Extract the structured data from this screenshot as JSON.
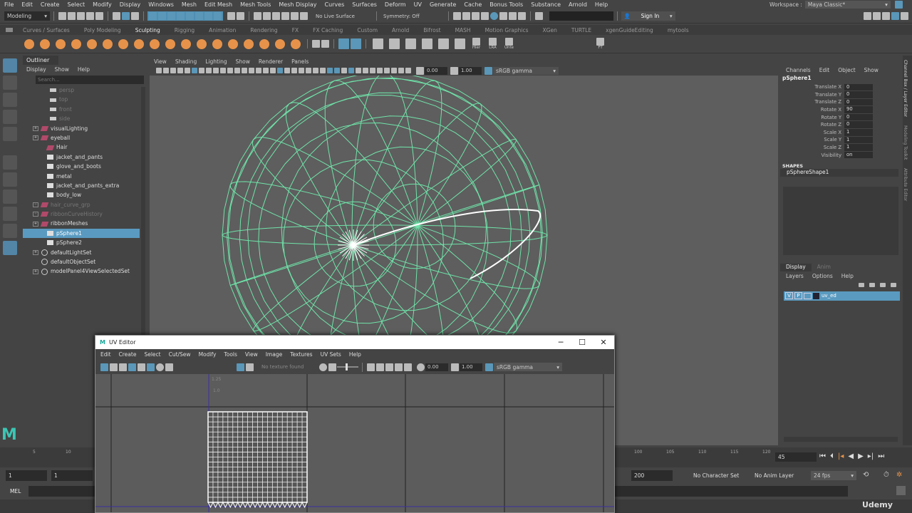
{
  "menubar": [
    "File",
    "Edit",
    "Create",
    "Select",
    "Modify",
    "Display",
    "Windows",
    "Mesh",
    "Edit Mesh",
    "Mesh Tools",
    "Mesh Display",
    "Curves",
    "Surfaces",
    "Deform",
    "UV",
    "Generate",
    "Cache",
    "Bonus Tools",
    "Substance",
    "Arnold",
    "Help"
  ],
  "workspace": {
    "label": "Workspace :",
    "value": "Maya Classic*"
  },
  "status": {
    "mode": "Modeling",
    "live_surface": "No Live Surface",
    "symmetry": "Symmetry: Off",
    "sign_in": "Sign In"
  },
  "shelf_tabs": [
    "Curves / Surfaces",
    "Poly Modeling",
    "Sculpting",
    "Rigging",
    "Animation",
    "Rendering",
    "FX",
    "FX Caching",
    "Custom",
    "Arnold",
    "Bifrost",
    "MASH",
    "Motion Graphics",
    "XGen",
    "TURTLE",
    "xgenGuideEditing",
    "mytools"
  ],
  "shelf_active": "Sculpting",
  "shelf_labels": [
    "Hier",
    "LRA",
    "Unte",
    "FT"
  ],
  "outliner": {
    "title": "Outliner",
    "menu": [
      "Display",
      "Show",
      "Help"
    ],
    "search_placeholder": "Search...",
    "items": [
      {
        "name": "persp",
        "type": "cam",
        "dim": true,
        "exp": false
      },
      {
        "name": "top",
        "type": "cam",
        "dim": true,
        "exp": false
      },
      {
        "name": "front",
        "type": "cam",
        "dim": true,
        "exp": false
      },
      {
        "name": "side",
        "type": "cam",
        "dim": true,
        "exp": false
      },
      {
        "name": "visualLighting",
        "type": "grp",
        "exp": true
      },
      {
        "name": "eyeball",
        "type": "grp",
        "exp": true
      },
      {
        "name": "Hair",
        "type": "grp",
        "exp": false
      },
      {
        "name": "jacket_and_pants",
        "type": "mesh",
        "exp": false
      },
      {
        "name": "glove_and_boots",
        "type": "mesh",
        "exp": false
      },
      {
        "name": "metal",
        "type": "mesh",
        "exp": false
      },
      {
        "name": "jacket_and_pants_extra",
        "type": "mesh",
        "exp": false
      },
      {
        "name": "body_low",
        "type": "mesh",
        "exp": false
      },
      {
        "name": "hair_curve_grp",
        "type": "grp",
        "dim": true,
        "exp": true
      },
      {
        "name": "ribbonCurveHistory",
        "type": "grp",
        "dim": true,
        "exp": true
      },
      {
        "name": "ribbonMeshes",
        "type": "grp",
        "exp": true
      },
      {
        "name": "pSphere1",
        "type": "mesh",
        "exp": false,
        "selected": true
      },
      {
        "name": "pSphere2",
        "type": "mesh",
        "exp": false
      },
      {
        "name": "defaultLightSet",
        "type": "set",
        "exp": true
      },
      {
        "name": "defaultObjectSet",
        "type": "set",
        "exp": false
      },
      {
        "name": "modelPanel4ViewSelectedSet",
        "type": "set",
        "exp": true
      }
    ]
  },
  "viewport": {
    "menu": [
      "View",
      "Shading",
      "Lighting",
      "Show",
      "Renderer",
      "Panels"
    ],
    "exposure": "0.00",
    "gamma": "1.00",
    "colorspace": "sRGB gamma",
    "wire_color": "#6fe3a9"
  },
  "channelbox": {
    "menu": [
      "Channels",
      "Edit",
      "Object",
      "Show"
    ],
    "object": "pSphere1",
    "attrs": [
      {
        "l": "Translate X",
        "v": "0"
      },
      {
        "l": "Translate Y",
        "v": "0"
      },
      {
        "l": "Translate Z",
        "v": "0"
      },
      {
        "l": "Rotate X",
        "v": "90"
      },
      {
        "l": "Rotate Y",
        "v": "0"
      },
      {
        "l": "Rotate Z",
        "v": "0"
      },
      {
        "l": "Scale X",
        "v": "1"
      },
      {
        "l": "Scale Y",
        "v": "1"
      },
      {
        "l": "Scale Z",
        "v": "1"
      },
      {
        "l": "Visibility",
        "v": "on"
      }
    ],
    "shapes_label": "SHAPES",
    "shape": "pSphereShape1"
  },
  "layers": {
    "tabs": [
      "Display",
      "Anim"
    ],
    "menu": [
      "Layers",
      "Options",
      "Help"
    ],
    "layer": {
      "v": "V",
      "p": "P",
      "name": "uv_ed"
    }
  },
  "side_tabs": [
    "Channel Box / Layer Editor",
    "Modeling Toolkit",
    "Attribute Editor"
  ],
  "timeline": {
    "ticks_left": [
      "5",
      "10"
    ],
    "ticks_right": [
      "100",
      "105",
      "110",
      "115",
      "120"
    ],
    "current": "45"
  },
  "range": {
    "start": "1",
    "start2": "1",
    "end": "200",
    "character": "No Character Set",
    "anim_layer": "No Anim Layer",
    "fps": "24 fps"
  },
  "cmd": {
    "lang": "MEL"
  },
  "watermark": "Udemy",
  "uv_editor": {
    "title": "UV Editor",
    "menu": [
      "Edit",
      "Create",
      "Select",
      "Cut/Sew",
      "Modify",
      "Tools",
      "View",
      "Image",
      "Textures",
      "UV Sets",
      "Help"
    ],
    "texture": "No texture found",
    "exposure": "0.00",
    "gamma": "1.00",
    "colorspace": "sRGB gamma",
    "labels": [
      "1.25",
      "1.0"
    ]
  }
}
